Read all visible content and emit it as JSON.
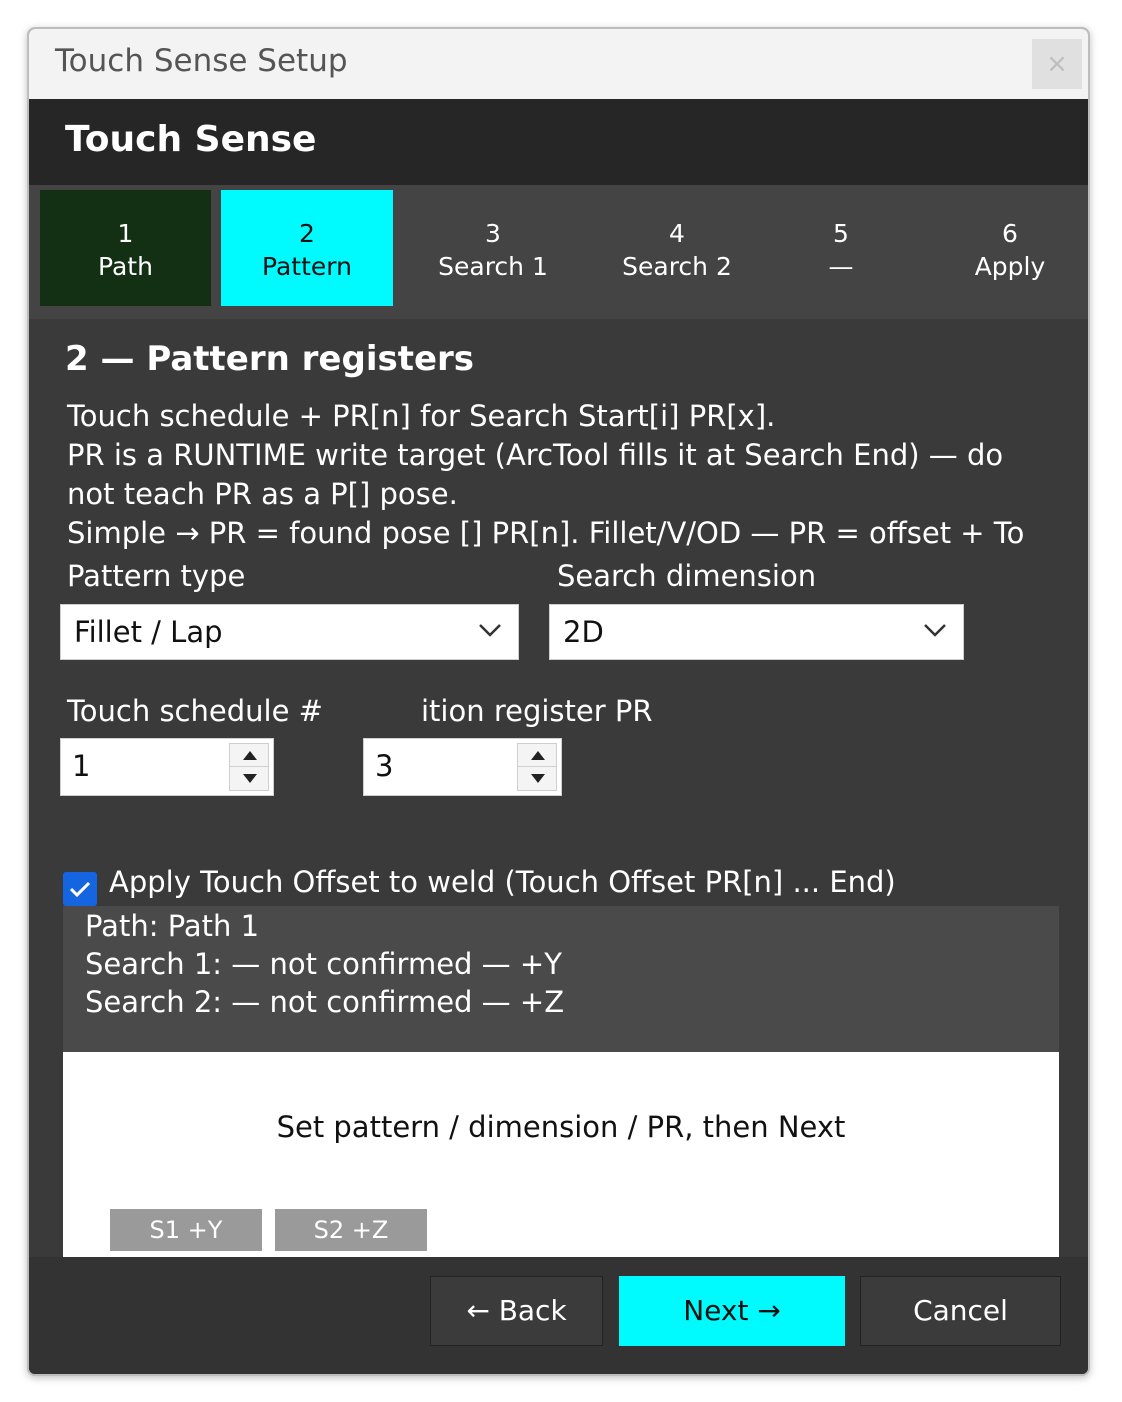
{
  "window": {
    "title": "Touch Sense Setup",
    "close_glyph": "×"
  },
  "header": {
    "title": "Touch Sense"
  },
  "tabs": [
    {
      "num": "1",
      "label": "Path",
      "state": "done"
    },
    {
      "num": "2",
      "label": "Pattern",
      "state": "active"
    },
    {
      "num": "3",
      "label": "Search 1",
      "state": "pending"
    },
    {
      "num": "4",
      "label": "Search 2",
      "state": "pending"
    },
    {
      "num": "5",
      "label": "—",
      "state": "pending"
    },
    {
      "num": "6",
      "label": "Apply",
      "state": "pending"
    }
  ],
  "section": {
    "title": "2 — Pattern registers",
    "lines": [
      "Touch schedule + PR[n] for Search Start[i] PR[x].",
      "PR is a RUNTIME write target (ArcTool fills it at Search End) — do",
      "not teach PR as a P[] pose.",
      "Simple → PR = found pose [] PR[n]. Fillet/V/OD — PR = offset + To"
    ]
  },
  "form": {
    "pattern_type_label": "Pattern type",
    "pattern_type_value": "Fillet / Lap",
    "search_dimension_label": "Search dimension",
    "search_dimension_value": "2D",
    "touch_schedule_label": "Touch schedule #",
    "touch_schedule_value": "1",
    "position_register_label": "ition register PR",
    "position_register_value": "3",
    "apply_offset_label": "Apply Touch Offset to weld (Touch Offset PR[n] ... End)",
    "apply_offset_checked": true
  },
  "summary": {
    "path": "Path: Path 1",
    "search1": "Search 1: — not confirmed —  +Y",
    "search2": "Search 2: — not confirmed —  +Z"
  },
  "preview": {
    "message": "Set pattern / dimension / PR, then Next",
    "chips": [
      "S1 +Y",
      "S2 +Z"
    ]
  },
  "footer": {
    "back": "← Back",
    "next": "Next →",
    "cancel": "Cancel"
  },
  "colors": {
    "accent": "#00fbff",
    "done_tab": "#133014",
    "checkbox": "#1565e0"
  },
  "icons": [
    "close-icon",
    "chevron-down-icon",
    "spin-up-icon",
    "spin-down-icon",
    "checkmark-icon"
  ]
}
